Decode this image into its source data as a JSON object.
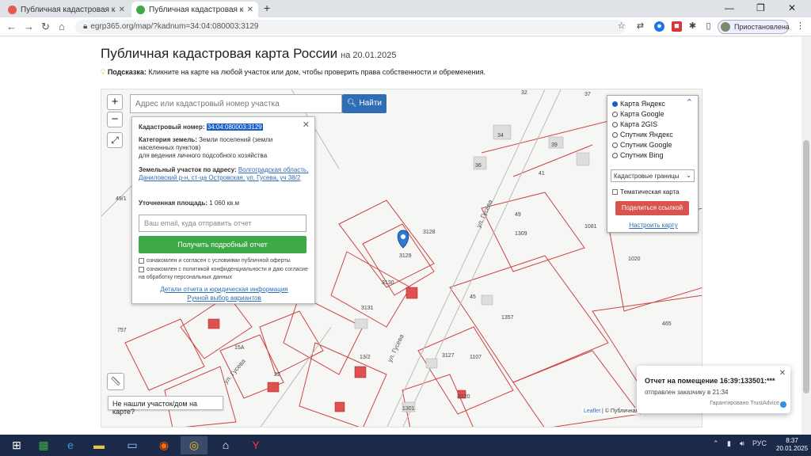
{
  "browser": {
    "tabs": [
      {
        "title": "Публичная кадастровая карта",
        "favicon_color": "#e55a4e"
      },
      {
        "title": "Публичная кадастровая карта",
        "favicon_color": "#3daa47"
      }
    ],
    "url": "egrp365.org/map/?kadnum=34:04:080003:3129",
    "profile_label": "Приостановлена"
  },
  "page": {
    "title": "Публичная кадастровая карта России",
    "date": "на 20.01.2025",
    "hint_label": "Подсказка:",
    "hint_text": "Кликните на карте на любой участок или дом, чтобы проверить права собственности и обременения."
  },
  "map": {
    "search_placeholder": "Адрес или кадастровый номер участка",
    "search_button": "Найти",
    "zoom_in": "+",
    "zoom_out": "−",
    "not_found": "Не нашли участок/дом на карте?",
    "attribution_prefix": "Leaflet",
    "attribution_rest": "| © Публичная",
    "parcel_labels": [
      "32",
      "37",
      "34",
      "39",
      "36",
      "41",
      "49/1",
      "49",
      "3128",
      "3129",
      "1309",
      "1081",
      "1020",
      "3130",
      "45",
      "1357",
      "3131",
      "13/2",
      "15А",
      "22",
      "3127",
      "1107",
      "1301",
      "465",
      "757",
      "3120"
    ],
    "street_labels": [
      "ул. Гусева",
      "ул. Гусева",
      "ул. Гусева"
    ],
    "accent": "#c0392b"
  },
  "popup": {
    "cadastral_label": "Кадастровый номер:",
    "cadastral_value": "34:04:080003:3129",
    "category_label": "Категория земель:",
    "category_value": "Земли поселений (земли населенных пунктов)",
    "usage": "для ведения личного подсобного хозяйства",
    "address_label": "Земельный участок по адресу:",
    "address_value": "Волгоградская область, Даниловский р-н, ст-ца Островская, ул. Гусева, уч 38/2",
    "area_label": "Уточненная площадь:",
    "area_value": "1 060 кв.м",
    "email_placeholder": "Ваш email, куда отправить отчет",
    "get_report": "Получить подробный отчет",
    "consent1": "ознакомлен и согласен с условиями публичной оферты",
    "consent2": "ознакомлен с политикой конфиденциальности и даю согласие на обработку персональных данных",
    "details_link": "Детали отчета и юридическая информация",
    "manual_link": "Ручной выбор вариантов"
  },
  "layers": {
    "options": [
      "Карта Яндекс",
      "Карта Google",
      "Карта 2GIS",
      "Спутник Яндекс",
      "Спутник Google",
      "Спутник Bing"
    ],
    "selected": 0,
    "boundaries": "Кадастровые границы",
    "thematic": "Тематическая карта",
    "share": "Поделиться ссылкой",
    "setup": "Настроить карту"
  },
  "toast": {
    "title": "Отчет на помещение 16:39:133501:***",
    "subtitle": "отправлен заказчику в 21:34",
    "footer": "Гарантировано TrustAdvice"
  },
  "taskbar": {
    "lang": "РУС",
    "time": "8:37",
    "date": "20.01.2025"
  }
}
